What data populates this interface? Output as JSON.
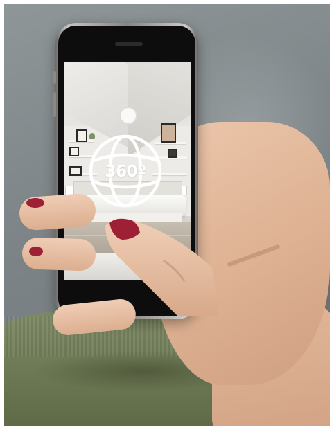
{
  "overlay": {
    "badge_text": "360º",
    "badge_icon": "360-globe-icon"
  },
  "colors": {
    "nail_polish": "#9e2034",
    "badge": "#ffffff",
    "sweater": "#6e7a55"
  }
}
